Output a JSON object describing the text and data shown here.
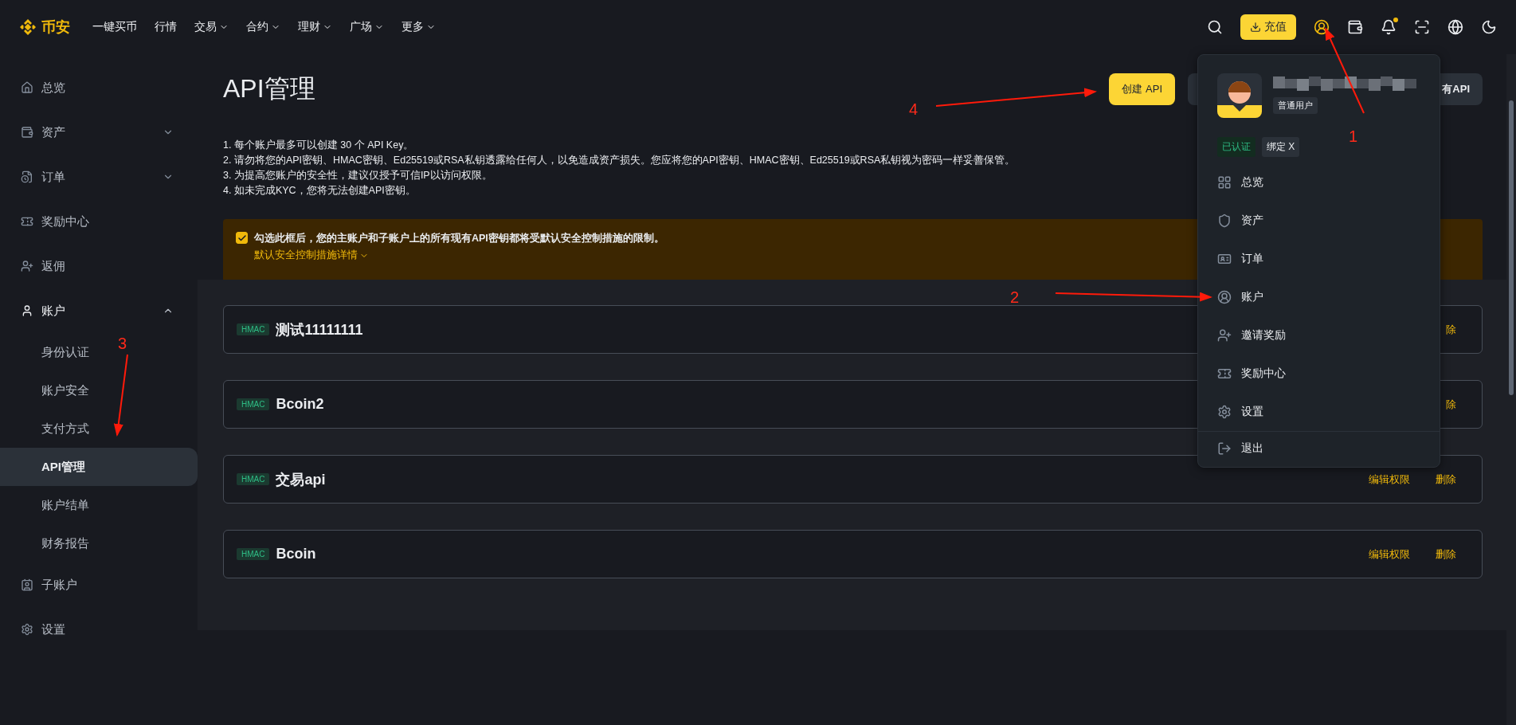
{
  "nav": {
    "logo": "币安",
    "items": [
      {
        "label": "一键买币",
        "dropdown": false
      },
      {
        "label": "行情",
        "dropdown": false
      },
      {
        "label": "交易",
        "dropdown": true
      },
      {
        "label": "合约",
        "dropdown": true
      },
      {
        "label": "理财",
        "dropdown": true
      },
      {
        "label": "广场",
        "dropdown": true
      },
      {
        "label": "更多",
        "dropdown": true
      }
    ],
    "deposit_button": "充值",
    "notification_dot": true
  },
  "sidebar": {
    "items": [
      {
        "label": "总览",
        "expandable": false,
        "expanded": false,
        "selected": false
      },
      {
        "label": "资产",
        "expandable": true,
        "expanded": false,
        "selected": false
      },
      {
        "label": "订单",
        "expandable": true,
        "expanded": false,
        "selected": false
      },
      {
        "label": "奖励中心",
        "expandable": false,
        "expanded": false,
        "selected": false
      },
      {
        "label": "返佣",
        "expandable": false,
        "expanded": false,
        "selected": false
      },
      {
        "label": "账户",
        "expandable": true,
        "expanded": true,
        "selected": false,
        "children": [
          {
            "label": "身份认证",
            "selected": false
          },
          {
            "label": "账户安全",
            "selected": false
          },
          {
            "label": "支付方式",
            "selected": false
          },
          {
            "label": "API管理",
            "selected": true
          },
          {
            "label": "账户结单",
            "selected": false
          },
          {
            "label": "财务报告",
            "selected": false
          }
        ]
      },
      {
        "label": "子账户",
        "expandable": false,
        "expanded": false,
        "selected": false
      },
      {
        "label": "设置",
        "expandable": false,
        "expanded": false,
        "selected": false
      }
    ]
  },
  "page": {
    "title": "API管理",
    "buttons": [
      {
        "label": "创建 API",
        "kind": "primary"
      },
      {
        "label": "有API",
        "kind": "secondary"
      }
    ],
    "notes": [
      "1. 每个账户最多可以创建 30 个 API Key。",
      "2. 请勿将您的API密钥、HMAC密钥、Ed25519或RSA私钥透露给任何人，以免造成资产损失。您应将您的API密钥、HMAC密钥、Ed25519或RSA私钥视为密码一样妥善保管。",
      "3. 为提高您账户的安全性，建议仅授予可信IP以访问权限。",
      "4. 如未完成KYC，您将无法创建API密钥。"
    ],
    "warning": {
      "checked": true,
      "text": "勾选此框后，您的主账户和子账户上的所有现有API密钥都将受默认安全控制措施的限制。",
      "link": "默认安全控制措施详情"
    }
  },
  "api_keys": [
    {
      "type": "HMAC",
      "name": "测试11111111",
      "actions": [
        "除"
      ]
    },
    {
      "type": "HMAC",
      "name": "Bcoin2",
      "actions": [
        "除"
      ]
    },
    {
      "type": "HMAC",
      "name": "交易api",
      "actions": [
        "编辑权限",
        "删除"
      ]
    },
    {
      "type": "HMAC",
      "name": "Bcoin",
      "actions": [
        "编辑权限",
        "删除"
      ]
    }
  ],
  "user_menu": {
    "role": "普通用户",
    "badges": [
      {
        "label": "已认证",
        "kind": "verified"
      },
      {
        "label": "绑定 X",
        "kind": "plain"
      }
    ],
    "items": [
      {
        "label": "总览"
      },
      {
        "label": "资产"
      },
      {
        "label": "订单"
      },
      {
        "label": "账户"
      },
      {
        "label": "邀请奖励"
      },
      {
        "label": "奖励中心"
      },
      {
        "label": "设置"
      }
    ],
    "logout": "退出"
  },
  "annotations": [
    {
      "label": "1"
    },
    {
      "label": "2"
    },
    {
      "label": "3"
    },
    {
      "label": "4"
    }
  ]
}
